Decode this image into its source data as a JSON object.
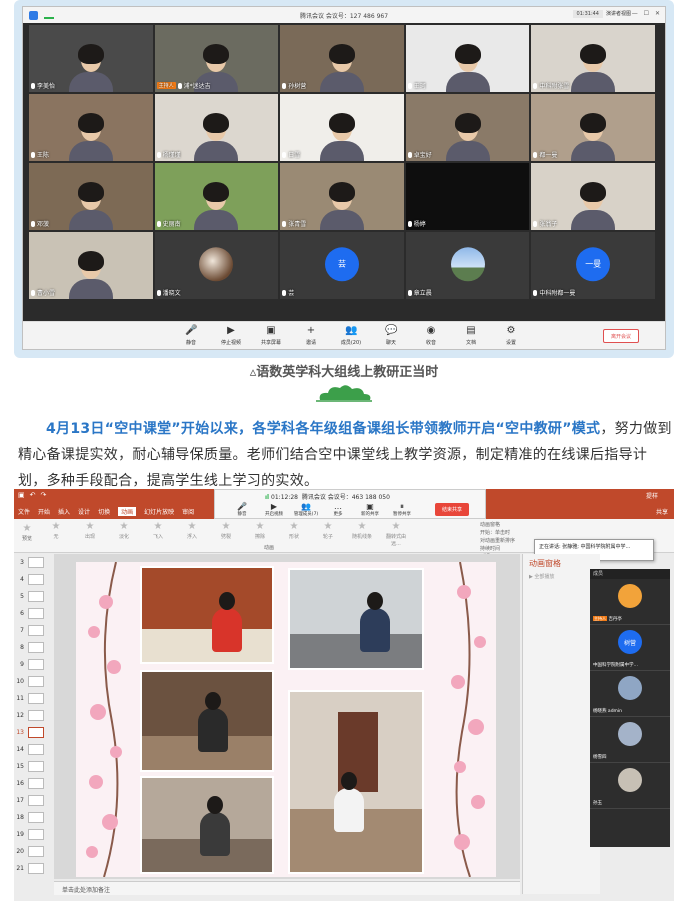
{
  "meeting1": {
    "title": "腾讯会议 会议号：127 486 967",
    "timer": "01:31:44",
    "view_label": "演讲者视图",
    "tiles": [
      {
        "name": "李美怡",
        "bg": "#4a4a4a",
        "kind": "person"
      },
      {
        "name": "浦*迷达吉",
        "bg": "#6b6b60",
        "kind": "person",
        "host": "主持人"
      },
      {
        "name": "孙树营",
        "bg": "#7a6a58",
        "kind": "person"
      },
      {
        "name": "王珂",
        "bg": "#e9e9e9",
        "kind": "person"
      },
      {
        "name": "中科附张雪",
        "bg": "#d9d4cc",
        "kind": "person"
      },
      {
        "name": "王陈",
        "bg": "#8a7460",
        "kind": "person"
      },
      {
        "name": "杨瑾瑾",
        "bg": "#dcd7cf",
        "kind": "person"
      },
      {
        "name": "日雪",
        "bg": "#f0eeea",
        "kind": "person"
      },
      {
        "name": "卓宝好",
        "bg": "#8a7a68",
        "kind": "person"
      },
      {
        "name": "都一曼",
        "bg": "#b09f8c",
        "kind": "person"
      },
      {
        "name": "邓菠",
        "bg": "#7d6a55",
        "kind": "person"
      },
      {
        "name": "史丽南",
        "bg": "#7ea05a",
        "kind": "person"
      },
      {
        "name": "张青雪",
        "bg": "#9a8a74",
        "kind": "person"
      },
      {
        "name": "杨婷",
        "bg": "#0e0e0e",
        "kind": "empty"
      },
      {
        "name": "张翁子",
        "bg": "#d8d2c8",
        "kind": "person"
      },
      {
        "name": "曹小雪",
        "bg": "#c9c2b5",
        "kind": "person"
      },
      {
        "name": "潘晓文",
        "bg": "#3a3a3a",
        "kind": "photo"
      },
      {
        "name": "芸",
        "bg": "#3a3a3a",
        "kind": "avatar",
        "avatar_text": "芸"
      },
      {
        "name": "章立晨",
        "bg": "#3a3a3a",
        "kind": "sky"
      },
      {
        "name": "中科附都一曼",
        "bg": "#3a3a3a",
        "kind": "avatar",
        "avatar_text": "一曼"
      }
    ],
    "toolbar": [
      {
        "label": "静音",
        "icon": "🎤"
      },
      {
        "label": "停止视频",
        "icon": "▶"
      },
      {
        "label": "共享屏幕",
        "icon": "▣"
      },
      {
        "label": "邀请",
        "icon": "+"
      },
      {
        "label": "成员(20)",
        "icon": "👥"
      },
      {
        "label": "聊天",
        "icon": "💬"
      },
      {
        "label": "收音",
        "icon": "◉"
      },
      {
        "label": "文档",
        "icon": "▤"
      },
      {
        "label": "设置",
        "icon": "⚙"
      }
    ],
    "end_label": "离开会议"
  },
  "caption": "▵语数英学科大组线上教研正当时",
  "paragraph": {
    "highlight": "4月13日“空中课堂”开始以来，各学科各年级组备课组长带领教师开启“空中教研”模式",
    "rest": "，努力做到精心备课提实效，耐心辅导保质量。老师们结合空中课堂线上教学资源，制定精准的在线课后指导计划，多种手段配合，提高学生线上学习的实效。"
  },
  "ppt": {
    "tabs": [
      "文件",
      "开始",
      "插入",
      "设计",
      "切换",
      "动画",
      "幻灯片放映",
      "审阅"
    ],
    "active_tab": "动画",
    "user": "提样",
    "share": "共享",
    "meeting_bar": {
      "timer": "01:12:28",
      "info": "腾讯会议 会议号：463 188 050",
      "items": [
        {
          "label": "静音",
          "icon": "🎤"
        },
        {
          "label": "开启视频",
          "icon": "▶"
        },
        {
          "label": "管理成员(7)",
          "icon": "👥"
        },
        {
          "label": "更多",
          "icon": "…"
        },
        {
          "label": "新的共享",
          "icon": "▣"
        },
        {
          "label": "暂停共享",
          "icon": "⏸"
        }
      ],
      "end_label": "结束共享"
    },
    "animations": [
      "无",
      "出现",
      "淡化",
      "飞入",
      "浮入",
      "劈裂",
      "擦除",
      "形状",
      "轮子",
      "随机线条",
      "翻转式由远..."
    ],
    "preview_label": "预览",
    "group_label": "动画",
    "ribbon_right": [
      "动画窗格",
      "开始：单击时",
      "对动画重新排序",
      "持续时间",
      "延迟"
    ],
    "tooltip": "正在讲话: 张静雅; 中国科学院附属中学...",
    "thumb_numbers": [
      "3",
      "4",
      "5",
      "6",
      "7",
      "8",
      "9",
      "10",
      "11",
      "12",
      "13",
      "14",
      "15",
      "16",
      "17",
      "18",
      "19",
      "20",
      "21"
    ],
    "active_thumb": "13",
    "notes_label": "单击此处添加备注",
    "anim_pane_title": "动画窗格",
    "anim_pane_play": "▶ 全部播放",
    "people_header": "成员",
    "people": [
      {
        "name": "吉丹亭",
        "color": "#f2a33a",
        "host": "主持人"
      },
      {
        "name": "中国科学院附属中学…",
        "color": "#1e6cf0",
        "avatar_text": "树营"
      },
      {
        "name": "杨晓燕 admin",
        "color": "#8fa6c4"
      },
      {
        "name": "杨雪四",
        "color": "#a4b3c9"
      },
      {
        "name": "孙玉",
        "color": "#c7c0b5"
      }
    ]
  }
}
